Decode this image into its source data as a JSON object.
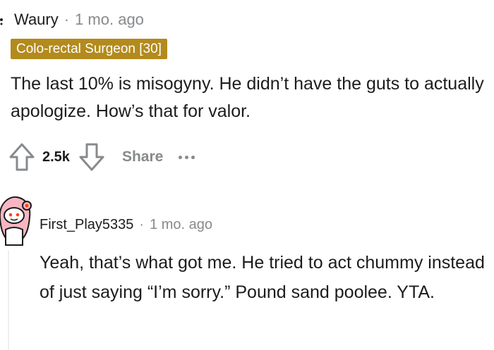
{
  "comment": {
    "author": "Waury",
    "separator": "·",
    "time": "1 mo. ago",
    "flair": "Colo-rectal Surgeon [30]",
    "body": "The last 10% is misogyny. He didn’t have the guts to actually apologize. How’s that for valor.",
    "score": "2.5k",
    "share_label": "Share"
  },
  "reply": {
    "author": "First_Play5335",
    "separator": "·",
    "time": "1 mo. ago",
    "body": "Yeah, that’s what got me. He tried to act chummy instead of just saying “I’m sorry.” Pound sand poolee. YTA."
  },
  "colors": {
    "flair_bg": "#b38a1c",
    "meta_gray": "#878a8c",
    "avatar_pink": "#f7b6c2"
  },
  "icons": [
    "upvote-icon",
    "downvote-icon",
    "more-options-icon",
    "user-avatar"
  ]
}
